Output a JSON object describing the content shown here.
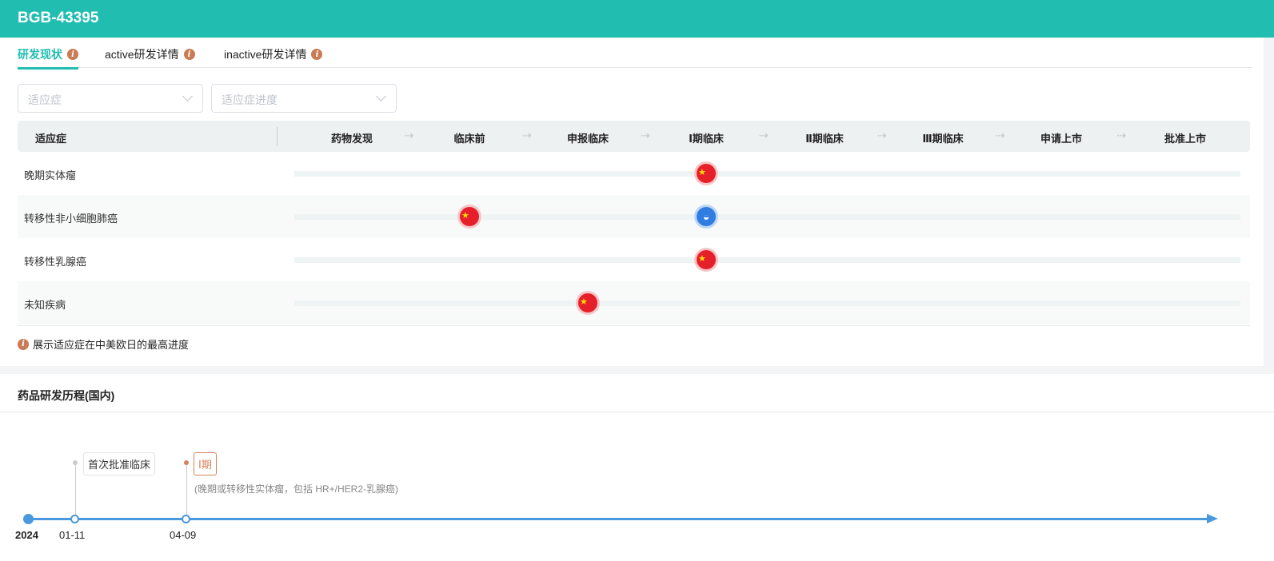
{
  "header": {
    "title": "BGB-43395"
  },
  "tabs": [
    {
      "label": "研发现状",
      "active": true
    },
    {
      "label": "active研发详情"
    },
    {
      "label": "inactive研发详情"
    }
  ],
  "filters": {
    "indication_placeholder": "适应症",
    "progress_placeholder": "适应症进度"
  },
  "table": {
    "indication_header": "适应症",
    "stages": [
      "药物发现",
      "临床前",
      "申报临床",
      "Ⅰ期临床",
      "Ⅱ期临床",
      "Ⅲ期临床",
      "申请上市",
      "批准上市"
    ],
    "rows": [
      {
        "name": "晚期实体瘤",
        "markers": [
          {
            "stage": 3,
            "region": "china-flag-icon"
          }
        ]
      },
      {
        "name": "转移性非小细胞肺癌",
        "markers": [
          {
            "stage": 1,
            "region": "china-flag-icon"
          },
          {
            "stage": 3,
            "region": "globe-icon"
          }
        ]
      },
      {
        "name": "转移性乳腺癌",
        "markers": [
          {
            "stage": 3,
            "region": "china-flag-icon"
          }
        ]
      },
      {
        "name": "未知疾病",
        "markers": [
          {
            "stage": 2,
            "region": "china-flag-icon"
          }
        ]
      }
    ],
    "note": "展示适应症在中美欧日的最高进度"
  },
  "history": {
    "title": "药品研发历程(国内)",
    "year": "2024",
    "events": [
      {
        "date": "01-11",
        "label": "首次批准临床"
      },
      {
        "date": "04-09",
        "label": "Ⅰ期",
        "detail": "(晚期或转移性实体瘤，包括 HR+/HER2-乳腺癌)"
      }
    ]
  },
  "colors": {
    "brand": "#20bdb0",
    "info": "#c97b55",
    "timeline": "#4a98dd",
    "phase": "#d7825a"
  }
}
